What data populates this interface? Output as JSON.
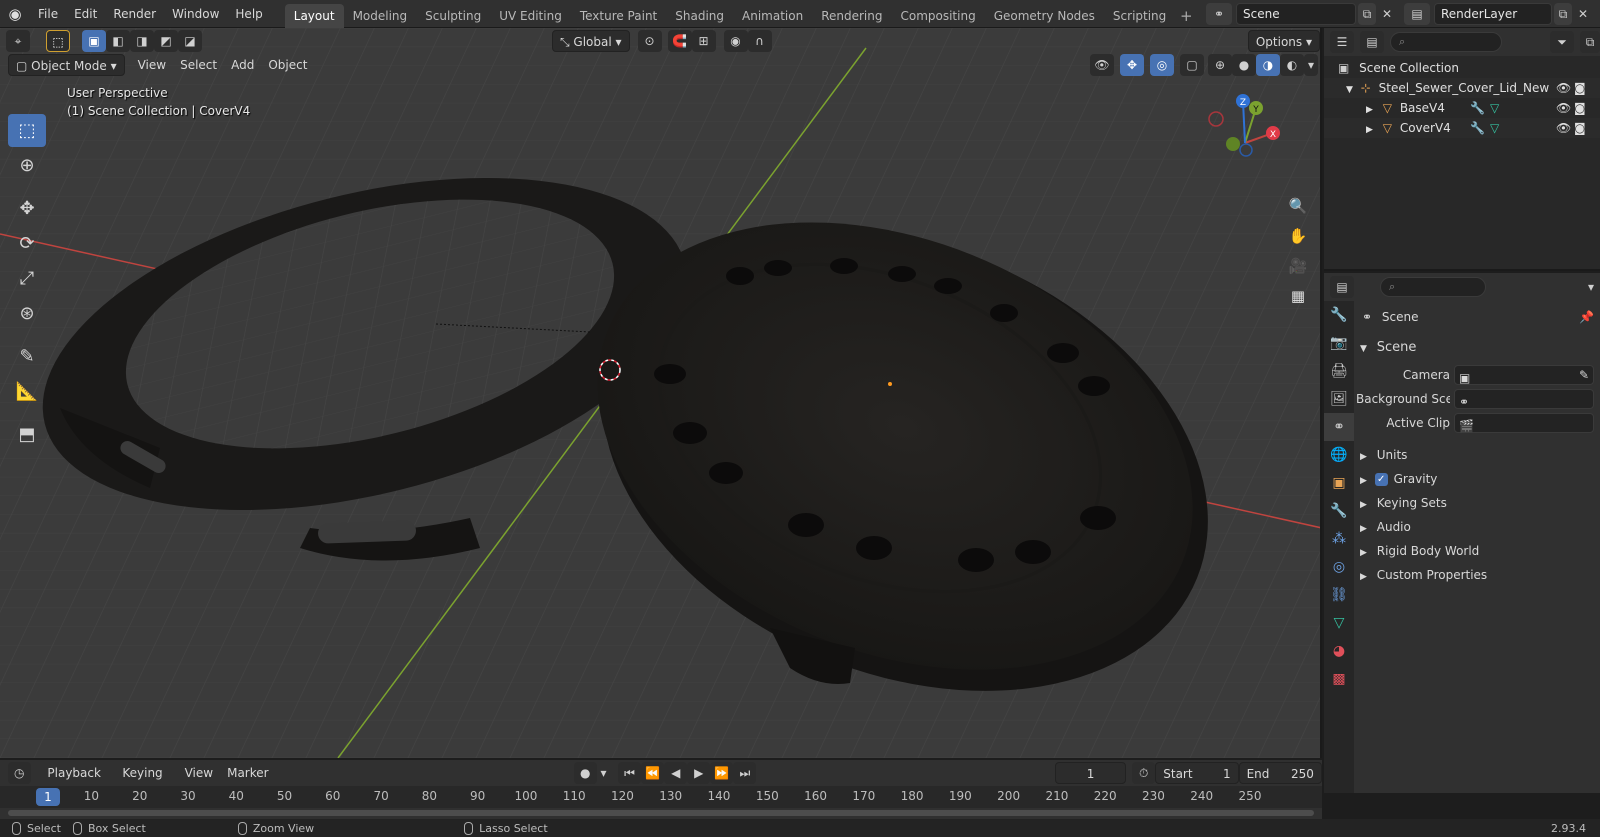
{
  "topbar": {
    "logo_icon": "blender-logo-icon",
    "menus": [
      "File",
      "Edit",
      "Render",
      "Window",
      "Help"
    ],
    "workspaces": [
      {
        "label": "Layout",
        "active": true
      },
      {
        "label": "Modeling",
        "active": false
      },
      {
        "label": "Sculpting",
        "active": false
      },
      {
        "label": "UV Editing",
        "active": false
      },
      {
        "label": "Texture Paint",
        "active": false
      },
      {
        "label": "Shading",
        "active": false
      },
      {
        "label": "Animation",
        "active": false
      },
      {
        "label": "Rendering",
        "active": false
      },
      {
        "label": "Compositing",
        "active": false
      },
      {
        "label": "Geometry Nodes",
        "active": false
      },
      {
        "label": "Scripting",
        "active": false
      }
    ],
    "add_tab_icon": "+",
    "scene_name": "Scene",
    "view_layer": "RenderLayer"
  },
  "viewport": {
    "header": {
      "mode": "Object Mode",
      "menus": [
        "View",
        "Select",
        "Add",
        "Object"
      ],
      "orientation": "Global",
      "options": "Options"
    },
    "info_line1": "User Perspective",
    "info_line2": "(1) Scene Collection | CoverV4",
    "gizmo": {
      "x": "X",
      "y": "Y",
      "z": "Z"
    },
    "colors": {
      "background": "#3d3d3d",
      "x_axis": "#c0443f",
      "y_axis": "#7ba22f",
      "selected": "#4772b3"
    }
  },
  "toolbar": {
    "tools": [
      "select-box",
      "cursor",
      "move",
      "rotate",
      "scale",
      "transform",
      "annotate",
      "measure",
      "add-cube"
    ]
  },
  "outliner": {
    "search_placeholder": "",
    "root": "Scene Collection",
    "items": [
      {
        "name": "Steel_Sewer_Cover_Lid_New",
        "depth": 1,
        "expanded": true
      },
      {
        "name": "BaseV4",
        "depth": 2,
        "expanded": false
      },
      {
        "name": "CoverV4",
        "depth": 2,
        "expanded": false
      }
    ]
  },
  "properties": {
    "context": "Scene",
    "section": "Scene",
    "fields": [
      {
        "label": "Camera",
        "value": ""
      },
      {
        "label": "Background Sce...",
        "value": ""
      },
      {
        "label": "Active Clip",
        "value": ""
      }
    ],
    "panels": [
      {
        "label": "Units",
        "checkbox": false
      },
      {
        "label": "Gravity",
        "checkbox": true
      },
      {
        "label": "Keying Sets",
        "checkbox": false
      },
      {
        "label": "Audio",
        "checkbox": false
      },
      {
        "label": "Rigid Body World",
        "checkbox": false
      },
      {
        "label": "Custom Properties",
        "checkbox": false
      }
    ]
  },
  "timeline": {
    "menus": [
      "Playback",
      "Keying",
      "View",
      "Marker"
    ],
    "current_frame": "1",
    "start_label": "Start",
    "start": "1",
    "end_label": "End",
    "end": "250",
    "ruler": [
      1,
      10,
      20,
      30,
      40,
      50,
      60,
      70,
      80,
      90,
      100,
      110,
      120,
      130,
      140,
      150,
      160,
      170,
      180,
      190,
      200,
      210,
      220,
      230,
      240,
      250
    ]
  },
  "statusbar": {
    "items": [
      "Select",
      "Box Select",
      "Zoom View",
      "Lasso Select"
    ],
    "version": "2.93.4"
  }
}
